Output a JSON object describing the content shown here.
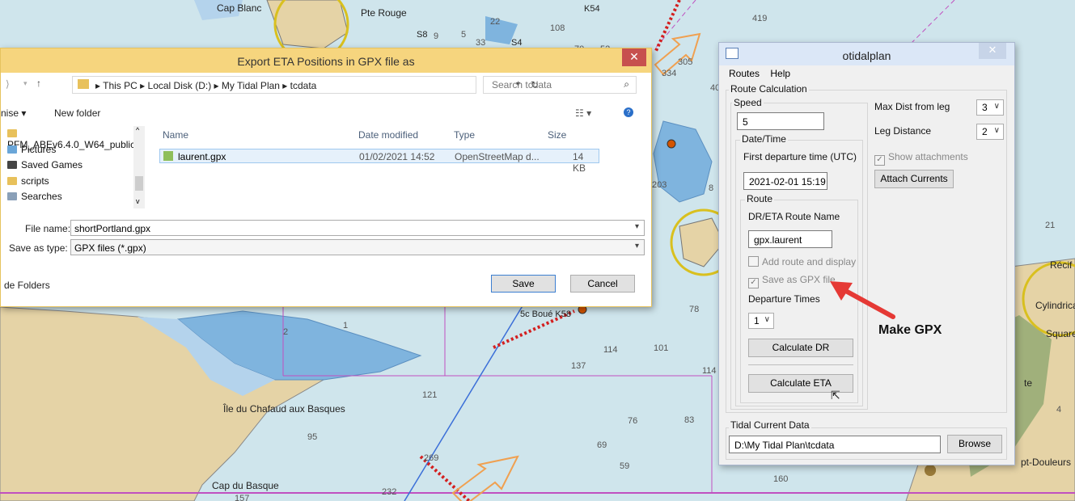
{
  "chart": {
    "place_cap_blanc": "Cap Blanc",
    "place_pte_rouge": "Pte Rouge",
    "place_ile_chafaud": "Île du Chafaud aux Basques",
    "place_cap_du_basque": "Cap du Basque",
    "buoy_k54": "K54",
    "buoy_s8": "S8",
    "buoy_s4": "S4",
    "buoy_boue": "5c Boué K58",
    "label_recif": "Récif",
    "label_cylindrical": "Cylindrica",
    "label_square": "Square",
    "label_pt_douleurs": "pt-Douleurs",
    "label_te": "te",
    "depths": [
      "108",
      "70",
      "52",
      "305",
      "334",
      "419",
      "22",
      "33",
      "203",
      "137",
      "114",
      "101",
      "121",
      "95",
      "69",
      "59",
      "83",
      "160",
      "78",
      "2",
      "1",
      "5",
      "9",
      "8",
      "21",
      "4",
      "157",
      "232",
      "76",
      "40",
      "114",
      "269"
    ]
  },
  "export_dialog": {
    "title": "Export ETA Positions in GPX file as",
    "breadcrumb": [
      "This PC",
      "Local Disk (D:)",
      "My Tidal Plan",
      "tcdata"
    ],
    "search_placeholder": "Search tcdata",
    "organise_label": "nise ▾",
    "new_folder_label": "New folder",
    "nav_items": [
      "PFM_ABEv6.4.0_W64_public",
      "Pictures",
      "Saved Games",
      "scripts",
      "Searches"
    ],
    "columns": [
      "Name",
      "Date modified",
      "Type",
      "Size"
    ],
    "files": [
      {
        "name": "laurent.gpx",
        "date": "01/02/2021 14:52",
        "type": "OpenStreetMap d...",
        "size": "14 KB"
      }
    ],
    "file_name_label": "File name:",
    "file_name_value": "shortPortland.gpx",
    "save_type_label": "Save as type:",
    "save_type_value": "GPX files (*.gpx)",
    "hide_folders_label": "de Folders",
    "save_label": "Save",
    "cancel_label": "Cancel"
  },
  "tidal_window": {
    "title": "otidalplan",
    "menu": [
      "Routes",
      "Help"
    ],
    "route_calc_label": "Route Calculation",
    "speed_label": "Speed",
    "speed_value": "5",
    "datetime_label": "Date/Time",
    "first_departure_label": "First departure time (UTC)",
    "first_departure_value": "2021-02-01  15:19",
    "route_label": "Route",
    "route_name_label": "DR/ETA Route Name",
    "route_name_value": "gpx.laurent",
    "add_route_label": "Add route and display",
    "save_gpx_label": "Save as GPX file",
    "departure_times_label": "Departure Times",
    "departure_times_value": "1",
    "calc_dr_label": "Calculate DR",
    "calc_eta_label": "Calculate ETA",
    "max_dist_label": "Max Dist from leg",
    "max_dist_value": "3",
    "leg_distance_label": "Leg Distance",
    "leg_distance_value": "2",
    "show_attachments_label": "Show attachments",
    "attach_currents_label": "Attach Currents",
    "tidal_current_label": "Tidal Current Data",
    "tidal_path_value": "D:\\My Tidal Plan\\tcdata",
    "browse_label": "Browse"
  },
  "annotation": {
    "text": "Make GPX",
    "arrow_color": "#e53935"
  }
}
